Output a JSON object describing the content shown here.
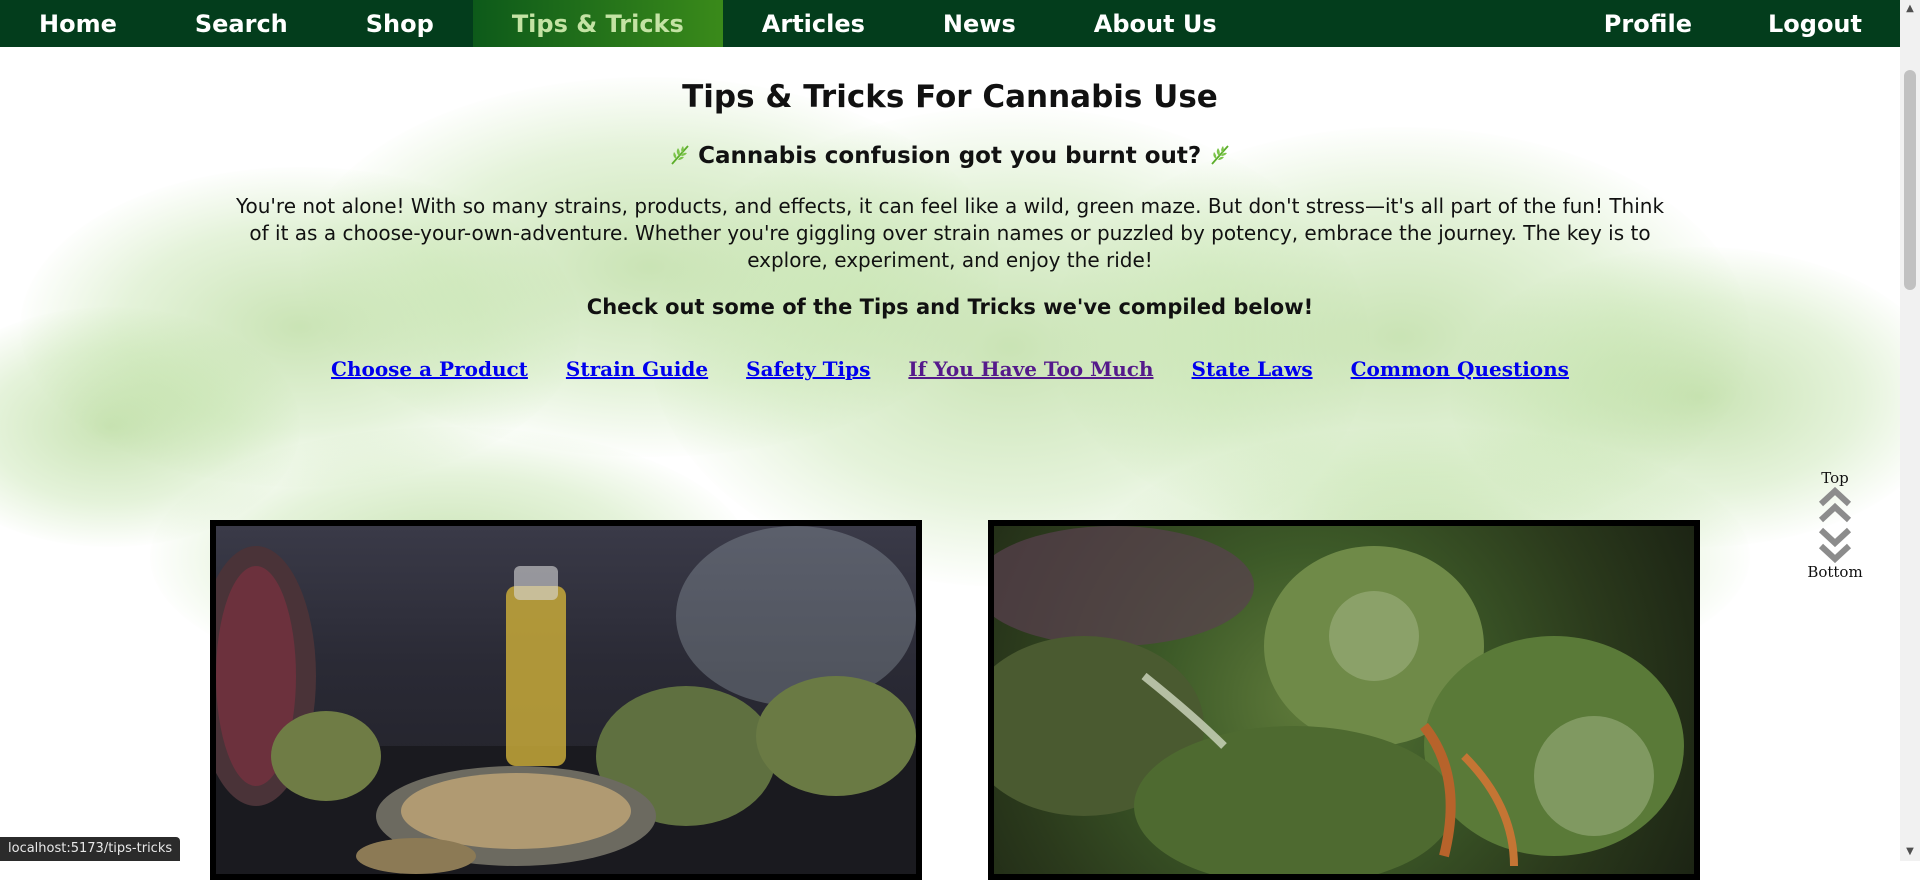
{
  "nav": {
    "items": [
      {
        "label": "Home"
      },
      {
        "label": "Search"
      },
      {
        "label": "Shop"
      },
      {
        "label": "Tips & Tricks",
        "active": true
      },
      {
        "label": "Articles"
      },
      {
        "label": "News"
      },
      {
        "label": "About Us"
      }
    ],
    "right_items": [
      {
        "label": "Profile"
      },
      {
        "label": "Logout"
      }
    ],
    "colors": {
      "bar": "#033d1c",
      "active_text": "#c4e3a4"
    }
  },
  "page": {
    "title": "Tips & Tricks For Cannabis Use",
    "subheading": "Cannabis confusion got you burnt out?",
    "intro": "You're not alone! With so many strains, products, and effects, it can feel like a wild, green maze. But don't stress—it's all part of the fun! Think of it as a choose-your-own-adventure. Whether you're giggling over strain names or puzzled by potency, embrace the journey. The key is to explore, experiment, and enjoy the ride!",
    "cta": "Check out some of the Tips and Tricks we've compiled below!"
  },
  "section_links": [
    {
      "label": "Choose a Product"
    },
    {
      "label": "Strain Guide"
    },
    {
      "label": "Safety Tips"
    },
    {
      "label": "If You Have Too Much",
      "visited": true
    },
    {
      "label": "State Laws"
    },
    {
      "label": "Common Questions"
    }
  ],
  "jump": {
    "top_label": "Top",
    "bottom_label": "Bottom",
    "icon_up": "double-chevron-up-icon",
    "icon_down": "double-chevron-down-icon"
  },
  "cards": [
    {
      "image": "cannabis-products-photo"
    },
    {
      "image": "cannabis-bud-closeup-photo"
    }
  ],
  "status_bar": {
    "url": "localhost:5173/tips-tricks"
  }
}
